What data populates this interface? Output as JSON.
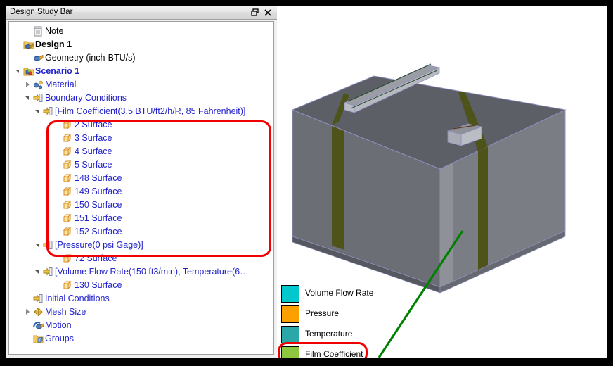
{
  "window": {
    "title": "Design Study Bar",
    "dock_icon": "restore-window-icon",
    "close_icon": "close-icon"
  },
  "tree": {
    "nodes": [
      {
        "label": "Note",
        "indent": 1,
        "expander": "none",
        "icon": "note-icon",
        "style": "black"
      },
      {
        "label": "Design 1",
        "indent": 0,
        "expander": "none",
        "icon": "design-icon",
        "style": "black bold"
      },
      {
        "label": "Geometry (inch-BTU/s)",
        "indent": 1,
        "expander": "none",
        "icon": "geometry-icon",
        "style": "black"
      },
      {
        "label": "Scenario 1",
        "indent": 0,
        "expander": "open",
        "icon": "scenario-icon",
        "style": "bold"
      },
      {
        "label": "Material",
        "indent": 1,
        "expander": "closed",
        "icon": "material-icon",
        "style": ""
      },
      {
        "label": "Boundary Conditions",
        "indent": 1,
        "expander": "open",
        "icon": "bc-icon",
        "style": ""
      },
      {
        "label": "[Film Coefficient(3.5 BTU/ft2/h/R, 85 Fahrenheit)]",
        "indent": 2,
        "expander": "open",
        "icon": "bc-icon",
        "style": ""
      },
      {
        "label": "2 Surface",
        "indent": 4,
        "expander": "none",
        "icon": "surface-icon",
        "style": ""
      },
      {
        "label": "3 Surface",
        "indent": 4,
        "expander": "none",
        "icon": "surface-icon",
        "style": ""
      },
      {
        "label": "4 Surface",
        "indent": 4,
        "expander": "none",
        "icon": "surface-icon",
        "style": ""
      },
      {
        "label": "5 Surface",
        "indent": 4,
        "expander": "none",
        "icon": "surface-icon",
        "style": ""
      },
      {
        "label": "148 Surface",
        "indent": 4,
        "expander": "none",
        "icon": "surface-icon",
        "style": ""
      },
      {
        "label": "149 Surface",
        "indent": 4,
        "expander": "none",
        "icon": "surface-icon",
        "style": ""
      },
      {
        "label": "150 Surface",
        "indent": 4,
        "expander": "none",
        "icon": "surface-icon",
        "style": ""
      },
      {
        "label": "151 Surface",
        "indent": 4,
        "expander": "none",
        "icon": "surface-icon",
        "style": ""
      },
      {
        "label": "152 Surface",
        "indent": 4,
        "expander": "none",
        "icon": "surface-icon",
        "style": ""
      },
      {
        "label": "[Pressure(0 psi Gage)]",
        "indent": 2,
        "expander": "open",
        "icon": "bc-icon",
        "style": ""
      },
      {
        "label": "72 Surface",
        "indent": 4,
        "expander": "none",
        "icon": "surface-icon",
        "style": ""
      },
      {
        "label": "[Volume Flow Rate(150 ft3/min), Temperature(6…",
        "indent": 2,
        "expander": "open",
        "icon": "bc-icon",
        "style": ""
      },
      {
        "label": "130 Surface",
        "indent": 4,
        "expander": "none",
        "icon": "surface-icon",
        "style": ""
      },
      {
        "label": "Initial Conditions",
        "indent": 1,
        "expander": "none",
        "icon": "bc-icon",
        "style": ""
      },
      {
        "label": "Mesh Size",
        "indent": 1,
        "expander": "closed",
        "icon": "mesh-icon",
        "style": ""
      },
      {
        "label": "Motion",
        "indent": 1,
        "expander": "none",
        "icon": "motion-icon",
        "style": ""
      },
      {
        "label": "Groups",
        "indent": 1,
        "expander": "none",
        "icon": "groups-icon",
        "style": ""
      }
    ]
  },
  "legend": {
    "items": [
      {
        "label": "Volume Flow Rate",
        "color": "#00c8cd"
      },
      {
        "label": "Pressure",
        "color": "#fca000"
      },
      {
        "label": "Temperature",
        "color": "#2aa8a8"
      },
      {
        "label": "Film Coefficient",
        "color": "#8dc63f"
      }
    ]
  },
  "annotations": {
    "surfaces_highlight": "red-rounded-box-around-film-coefficient-surfaces",
    "legend_highlight": "red-rounded-box-around-film-coefficient-legend",
    "callout_color": "#008000"
  },
  "model": {
    "description": "3D shaded box enclosure with two olive-green highlighted face bands, a long raised slot on the top face and a small raised block on the top face",
    "body_color": "#6e7176",
    "top_color": "#5d6066",
    "highlight_band_color": "#4e5319",
    "edge_color": "#8888bb"
  }
}
